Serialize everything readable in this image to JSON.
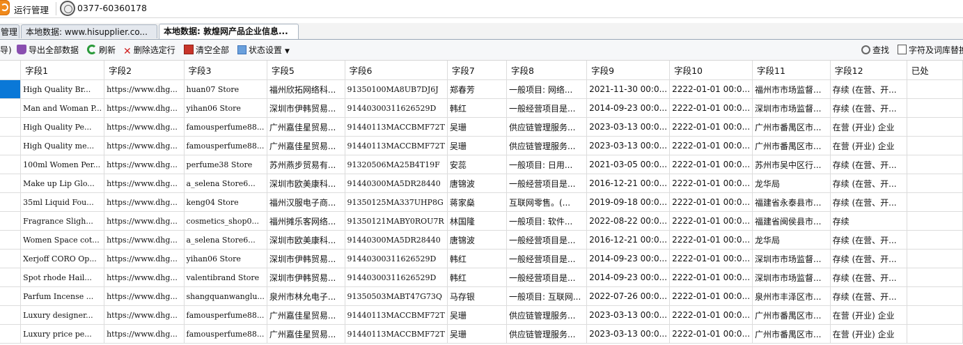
{
  "app": {
    "run_label": "运行管理",
    "phone": "0377-60360178"
  },
  "tabs": [
    {
      "label": "管理",
      "active": false
    },
    {
      "label": "本地数据: www.hisupplier.co...",
      "active": false
    },
    {
      "label": "本地数据: 敦煌网产品企业信息...",
      "active": true
    }
  ],
  "toolbar": {
    "partial_left": "导)",
    "export_all": "导出全部数据",
    "refresh": "刷新",
    "delete_selected": "删除选定行",
    "clear_all": "清空全部",
    "status_settings": "状态设置",
    "search": "查找",
    "char_replace": "字符及词库替换"
  },
  "grid": {
    "columns": [
      "字段1",
      "字段2",
      "字段3",
      "字段5",
      "字段6",
      "字段7",
      "字段8",
      "字段9",
      "字段10",
      "字段11",
      "字段12",
      "已处"
    ],
    "rows": [
      [
        "High Quality Br...",
        "https://www.dhg...",
        "huan07 Store",
        "福州欣拓网络科...",
        "91350100MA8UB7DJ6J",
        "郑春芳",
        "一般项目: 网络...",
        "2021-11-30 00:0...",
        "2222-01-01 00:0...",
        "福州市市场监督...",
        "存续 (在营、开...",
        ""
      ],
      [
        "Man and Woman P...",
        "https://www.dhg...",
        "yihan06 Store",
        "深圳市伊韩贸易...",
        "91440300311626529D",
        "韩红",
        "一般经营项目是...",
        "2014-09-23 00:0...",
        "2222-01-01 00:0...",
        "深圳市市场监督...",
        "存续 (在营、开...",
        ""
      ],
      [
        "High Quality Pe...",
        "https://www.dhg...",
        "famousperfume88...",
        "广州嘉佳星贸易...",
        "91440113MACCBMF72T",
        "吴珊",
        "供应链管理服务...",
        "2023-03-13 00:0...",
        "2222-01-01 00:0...",
        "广州市番禺区市...",
        "在营 (开业) 企业",
        ""
      ],
      [
        "High Quality me...",
        "https://www.dhg...",
        "famousperfume88...",
        "广州嘉佳星贸易...",
        "91440113MACCBMF72T",
        "吴珊",
        "供应链管理服务...",
        "2023-03-13 00:0...",
        "2222-01-01 00:0...",
        "广州市番禺区市...",
        "在营 (开业) 企业",
        ""
      ],
      [
        "100ml Women Per...",
        "https://www.dhg...",
        "perfume38 Store",
        "苏州燕步贸易有...",
        "91320506MA25B4T19F",
        "安蕊",
        "一般项目: 日用...",
        "2021-03-05 00:0...",
        "2222-01-01 00:0...",
        "苏州市吴中区行...",
        "存续 (在营、开...",
        ""
      ],
      [
        "Make up Lip Glo...",
        "https://www.dhg...",
        "a_selena Store6...",
        "深圳市欧美康科...",
        "91440300MA5DR28440",
        "唐锦波",
        "一般经营项目是...",
        "2016-12-21 00:0...",
        "2222-01-01 00:0...",
        "龙华局",
        "存续 (在营、开...",
        ""
      ],
      [
        "35ml Liquid Fou...",
        "https://www.dhg...",
        "keng04 Store",
        "福州汉服电子商...",
        "91350125MA337UHP8G",
        "蒋家燊",
        "互联网零售。(...",
        "2019-09-18 00:0...",
        "2222-01-01 00:0...",
        "福建省永泰县市...",
        "存续 (在营、开...",
        ""
      ],
      [
        "Fragrance Sligh...",
        "https://www.dhg...",
        "cosmetics_shop0...",
        "福州摊乐客网络...",
        "91350121MABY0ROU7R",
        "林国隆",
        "一般项目: 软件...",
        "2022-08-22 00:0...",
        "2222-01-01 00:0...",
        "福建省闽侯县市...",
        "存续",
        ""
      ],
      [
        "Women Space cot...",
        "https://www.dhg...",
        "a_selena Store6...",
        "深圳市欧美康科...",
        "91440300MA5DR28440",
        "唐锦波",
        "一般经营项目是...",
        "2016-12-21 00:0...",
        "2222-01-01 00:0...",
        "龙华局",
        "存续 (在营、开...",
        ""
      ],
      [
        "Xerjoff CORO Op...",
        "https://www.dhg...",
        "yihan06 Store",
        "深圳市伊韩贸易...",
        "91440300311626529D",
        "韩红",
        "一般经营项目是...",
        "2014-09-23 00:0...",
        "2222-01-01 00:0...",
        "深圳市市场监督...",
        "存续 (在营、开...",
        ""
      ],
      [
        "Spot rhode Hail...",
        "https://www.dhg...",
        "valentibrand Store",
        "深圳市伊韩贸易...",
        "91440300311626529D",
        "韩红",
        "一般经营项目是...",
        "2014-09-23 00:0...",
        "2222-01-01 00:0...",
        "深圳市市场监督...",
        "存续 (在营、开...",
        ""
      ],
      [
        "Parfum Incense ...",
        "https://www.dhg...",
        "shangquanwanglu...",
        "泉州市林允电子...",
        "91350503MABT47G73Q",
        "马存银",
        "一般项目: 互联网...",
        "2022-07-26 00:0...",
        "2222-01-01 00:0...",
        "泉州市丰泽区市...",
        "存续 (在营、开...",
        ""
      ],
      [
        "Luxury designer...",
        "https://www.dhg...",
        "famousperfume88...",
        "广州嘉佳星贸易...",
        "91440113MACCBMF72T",
        "吴珊",
        "供应链管理服务...",
        "2023-03-13 00:0...",
        "2222-01-01 00:0...",
        "广州市番禺区市...",
        "在营 (开业) 企业",
        ""
      ],
      [
        "Luxury price pe...",
        "https://www.dhg...",
        "famousperfume88...",
        "广州嘉佳星贸易...",
        "91440113MACCBMF72T",
        "吴珊",
        "供应链管理服务...",
        "2023-03-13 00:0...",
        "2222-01-01 00:0...",
        "广州市番禺区市...",
        "在营 (开业) 企业",
        ""
      ]
    ]
  }
}
